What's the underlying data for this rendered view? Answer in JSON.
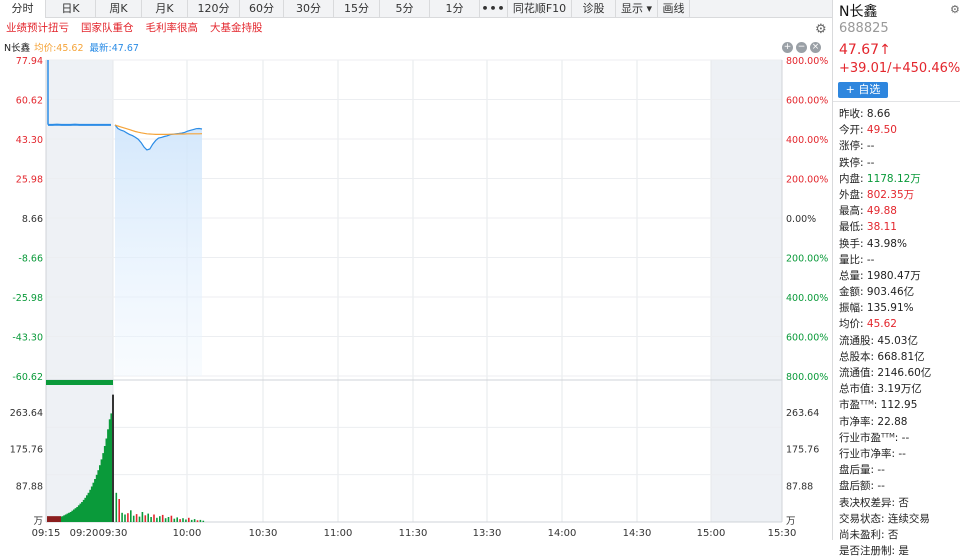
{
  "tabs": [
    "分时",
    "日K",
    "周K",
    "月K",
    "120分",
    "60分",
    "30分",
    "15分",
    "5分",
    "1分",
    "•••",
    "同花顺F10",
    "诊股",
    "显示 ▾",
    "画线"
  ],
  "tags": [
    "业绩预计扭亏",
    "国家队重仓",
    "毛利率很高",
    "大基金持股"
  ],
  "legend": {
    "name": "N长鑫",
    "avg": "均价:45.62",
    "last": "最新:47.67"
  },
  "zoom": {
    "plus": "+",
    "minus": "−",
    "close": "×"
  },
  "chart_data": {
    "type": "line",
    "prev_close": 8.66,
    "price_axis_left": [
      "77.94",
      "60.62",
      "43.30",
      "25.98",
      "8.66",
      "-8.66",
      "-25.98",
      "-43.30",
      "-60.62"
    ],
    "pct_axis_right": [
      "800.00%",
      "600.00%",
      "400.00%",
      "200.00%",
      "0.00%",
      "200.00%",
      "400.00%",
      "600.00%",
      "800.00%"
    ],
    "price_ylim": [
      -60.62,
      77.94
    ],
    "volume_axis": [
      "263.64",
      "175.76",
      "87.88"
    ],
    "volume_unit": "万",
    "x_ticks": [
      "09:15",
      "09:20",
      "09:30",
      "10:00",
      "10:30",
      "11:00",
      "11:30",
      "13:30",
      "14:00",
      "14:30",
      "15:00",
      "15:30"
    ],
    "auction_price": [
      49.5,
      49.5,
      49.6,
      49.5,
      49.5,
      49.5,
      49.6,
      49.5,
      49.5,
      49.5,
      49.5,
      49.5,
      49.5,
      49.5,
      49.5
    ],
    "series": [
      {
        "name": "最新",
        "values": [
          49.5,
          47.9,
          47.2,
          46.8,
          46.0,
          45.3,
          44.8,
          44.1,
          43.2,
          41.7,
          39.8,
          38.5,
          38.9,
          41.0,
          42.6,
          43.7,
          44.0,
          44.4,
          44.7,
          45.2,
          45.4,
          45.6,
          45.7,
          45.9,
          46.2,
          46.7,
          47.1,
          47.4,
          47.8,
          47.9,
          47.67
        ]
      },
      {
        "name": "均价",
        "values": [
          49.5,
          49.0,
          48.6,
          48.2,
          47.8,
          47.4,
          47.0,
          46.6,
          46.3,
          46.0,
          45.8,
          45.6,
          45.5,
          45.4,
          45.3,
          45.3,
          45.3,
          45.3,
          45.3,
          45.4,
          45.4,
          45.4,
          45.5,
          45.5,
          45.5,
          45.6,
          45.6,
          45.6,
          45.6,
          45.6,
          45.62
        ]
      }
    ],
    "auction_volume": [
      3,
      4,
      5,
      6,
      7,
      8,
      9,
      11,
      13,
      14,
      16,
      18,
      20,
      22,
      24,
      27,
      30,
      33,
      36,
      40,
      44,
      48,
      53,
      58,
      64,
      70,
      77,
      85,
      94,
      103,
      113,
      124,
      136,
      150,
      165,
      182,
      200,
      222,
      246,
      260
    ],
    "volume": [
      70,
      55,
      22,
      18,
      21,
      28,
      15,
      19,
      13,
      24,
      16,
      20,
      12,
      18,
      10,
      14,
      17,
      9,
      12,
      15,
      8,
      11,
      7,
      9,
      6,
      10,
      5,
      7,
      4,
      5,
      3
    ],
    "colors": {
      "price": "#2b8ce6",
      "avg": "#f5a43a",
      "up": "#e3262d",
      "down": "#0a9a3a",
      "fill": "#d6e9fb"
    }
  },
  "stock": {
    "name": "N长鑫",
    "code": "688825",
    "price": "47.67↑",
    "change": "+39.01/+450.46%",
    "add_watch": "+ 自选"
  },
  "stats": [
    {
      "label": "昨收:",
      "value": "8.66",
      "color": ""
    },
    {
      "label": "今开:",
      "value": "49.50",
      "color": "red"
    },
    {
      "label": "涨停:",
      "value": "--",
      "color": ""
    },
    {
      "label": "跌停:",
      "value": "--",
      "color": ""
    },
    {
      "label": "内盘:",
      "value": "1178.12万",
      "color": "green"
    },
    {
      "label": "外盘:",
      "value": "802.35万",
      "color": "red"
    },
    {
      "label": "最高:",
      "value": "49.88",
      "color": "red"
    },
    {
      "label": "最低:",
      "value": "38.11",
      "color": "red"
    },
    {
      "label": "换手:",
      "value": "43.98%",
      "color": ""
    },
    {
      "label": "量比:",
      "value": "--",
      "color": ""
    },
    {
      "label": "总量:",
      "value": "1980.47万",
      "color": ""
    },
    {
      "label": "金额:",
      "value": "903.46亿",
      "color": ""
    },
    {
      "label": "振幅:",
      "value": "135.91%",
      "color": ""
    },
    {
      "label": "均价:",
      "value": "45.62",
      "color": "red"
    },
    {
      "label": "流通股:",
      "value": "45.03亿",
      "color": ""
    },
    {
      "label": "总股本:",
      "value": "668.81亿",
      "color": ""
    },
    {
      "label": "流通值:",
      "value": "2146.60亿",
      "color": ""
    },
    {
      "label": "总市值:",
      "value": "3.19万亿",
      "color": ""
    },
    {
      "label": "市盈ᵀᵀᴹ:",
      "value": "112.95",
      "color": ""
    },
    {
      "label": "市净率:",
      "value": "22.88",
      "color": ""
    },
    {
      "label": "行业市盈ᵀᵀᴹ:",
      "value": "--",
      "color": ""
    },
    {
      "label": "行业市净率:",
      "value": "--",
      "color": ""
    },
    {
      "label": "盘后量:",
      "value": "--",
      "color": ""
    },
    {
      "label": "盘后额:",
      "value": "--",
      "color": ""
    },
    {
      "label": "表决权差异:",
      "value": "否",
      "color": ""
    },
    {
      "label": "交易状态:",
      "value": "连续交易",
      "color": ""
    },
    {
      "label": "尚未盈利:",
      "value": "否",
      "color": ""
    },
    {
      "label": "是否注册制:",
      "value": "是",
      "color": ""
    }
  ]
}
